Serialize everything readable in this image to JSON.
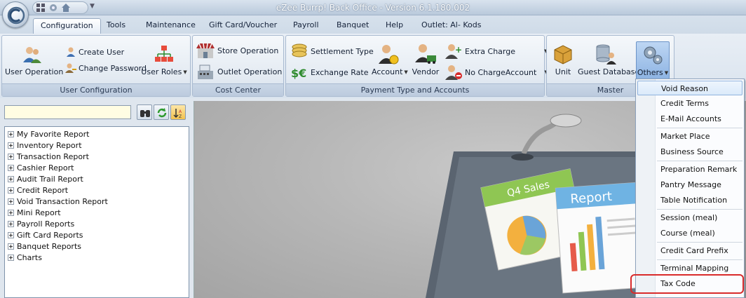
{
  "app": {
    "title": "eZee Burrp! Back Office - Version 6.1.180.002"
  },
  "tabs": [
    {
      "label": "Configuration",
      "active": true
    },
    {
      "label": "Tools"
    },
    {
      "label": "Maintenance"
    },
    {
      "label": "Gift Card/Voucher"
    },
    {
      "label": "Payroll"
    },
    {
      "label": "Banquet"
    },
    {
      "label": "Help"
    },
    {
      "label": "Outlet: Al- Kods"
    }
  ],
  "ribbon": {
    "user_configuration": {
      "label": "User Configuration",
      "user_operation": "User Operation",
      "create_user": "Create User",
      "change_password": "Change Password",
      "user_roles": "User Roles"
    },
    "cost_center": {
      "label": "Cost Center",
      "store_operation": "Store Operation",
      "outlet_operation": "Outlet Operation"
    },
    "payment": {
      "label": "Payment Type and Accounts",
      "settlement_type": "Settlement Type",
      "exchange_rate": "Exchange Rate",
      "account": "Account",
      "vendor": "Vendor",
      "extra_charge": "Extra Charge",
      "no_charge_account": "No ChargeAccount"
    },
    "master": {
      "label": "Master",
      "unit": "Unit",
      "guest_database": "Guest Database",
      "others": "Others"
    }
  },
  "search": {
    "value": ""
  },
  "tree": {
    "items": [
      "My Favorite Report",
      "Inventory Report",
      "Transaction Report",
      "Cashier Report",
      "Audit Trail Report",
      "Credit Report",
      "Void Transaction Report",
      "Mini Report",
      "Payroll Reports",
      "Gift Card Reports",
      "Banquet Reports",
      "Charts"
    ]
  },
  "illustration": {
    "card_text": "Q4 Sales",
    "report_text": "Report"
  },
  "others_menu": {
    "items": [
      "Void Reason",
      "Credit Terms",
      "E-Mail Accounts",
      "Market Place",
      "Business Source",
      "Preparation Remark",
      "Pantry Message",
      "Table Notification",
      "Session (meal)",
      "Course (meal)",
      "Credit Card Prefix",
      "Terminal Mapping",
      "Tax Code"
    ],
    "highlighted": "Void Reason",
    "outlined": "Tax Code"
  },
  "colors": {
    "highlight_outline": "#d92b2b",
    "search_background": "#fffde3"
  }
}
